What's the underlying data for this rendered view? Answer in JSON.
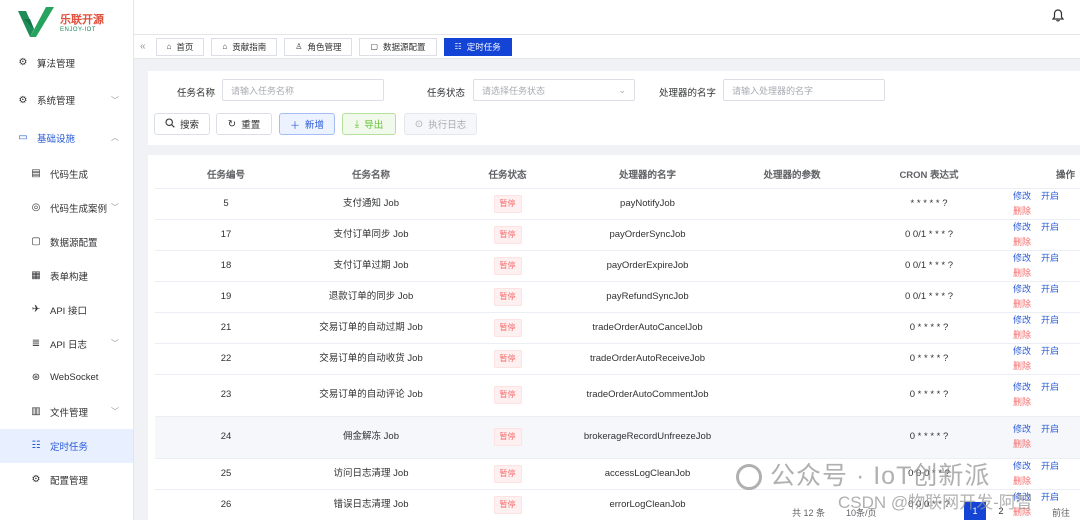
{
  "brand": {
    "title": "乐联开源",
    "subtitle": "ENJOY-IOT"
  },
  "sidebar": {
    "items": [
      {
        "label": "算法管理",
        "icon": "gear-icon",
        "level": 1
      },
      {
        "label": "系统管理",
        "icon": "gear-icon",
        "level": 1,
        "arrow": "down"
      },
      {
        "label": "基础设施",
        "icon": "monitor-icon",
        "level": 1,
        "arrow": "up",
        "open": true
      },
      {
        "label": "代码生成",
        "icon": "document-icon",
        "level": 2
      },
      {
        "label": "代码生成案例",
        "icon": "target-icon",
        "level": 2,
        "arrow": "down"
      },
      {
        "label": "数据源配置",
        "icon": "chat-icon",
        "level": 2
      },
      {
        "label": "表单构建",
        "icon": "form-icon",
        "level": 2
      },
      {
        "label": "API 接口",
        "icon": "plane-icon",
        "level": 2
      },
      {
        "label": "API 日志",
        "icon": "list-icon",
        "level": 2,
        "arrow": "down"
      },
      {
        "label": "WebSocket",
        "icon": "websocket-icon",
        "level": 2
      },
      {
        "label": "文件管理",
        "icon": "file-icon",
        "level": 2,
        "arrow": "down"
      },
      {
        "label": "定时任务",
        "icon": "task-list-icon",
        "level": 2,
        "active": true
      },
      {
        "label": "配置管理",
        "icon": "settings-icon",
        "level": 2
      }
    ]
  },
  "tags": [
    {
      "label": "首页",
      "icon": "home-icon"
    },
    {
      "label": "贡献指南",
      "icon": "home-icon"
    },
    {
      "label": "角色管理",
      "icon": "user-icon"
    },
    {
      "label": "数据源配置",
      "icon": "chat-icon"
    },
    {
      "label": "定时任务",
      "icon": "task-list-icon",
      "active": true
    }
  ],
  "search": {
    "name_label": "任务名称",
    "name_placeholder": "请输入任务名称",
    "status_label": "任务状态",
    "status_placeholder": "请选择任务状态",
    "handler_label": "处理器的名字",
    "handler_placeholder": "请输入处理器的名字",
    "btn_search": "搜索",
    "btn_reset": "重置",
    "btn_add": "新增",
    "btn_export": "导出",
    "btn_log": "执行日志"
  },
  "table": {
    "headers": [
      "任务编号",
      "任务名称",
      "任务状态",
      "处理器的名字",
      "处理器的参数",
      "CRON 表达式",
      "操作"
    ],
    "ops": {
      "edit": "修改",
      "start": "开启",
      "delete": "删除"
    },
    "rows": [
      {
        "id": "5",
        "name": "支付通知 Job",
        "status": "暂停",
        "handler": "payNotifyJob",
        "param": "",
        "cron": "* * * * * ?"
      },
      {
        "id": "17",
        "name": "支付订单同步 Job",
        "status": "暂停",
        "handler": "payOrderSyncJob",
        "param": "",
        "cron": "0 0/1 * * * ?"
      },
      {
        "id": "18",
        "name": "支付订单过期 Job",
        "status": "暂停",
        "handler": "payOrderExpireJob",
        "param": "",
        "cron": "0 0/1 * * * ?"
      },
      {
        "id": "19",
        "name": "退款订单的同步 Job",
        "status": "暂停",
        "handler": "payRefundSyncJob",
        "param": "",
        "cron": "0 0/1 * * * ?"
      },
      {
        "id": "21",
        "name": "交易订单的自动过期 Job",
        "status": "暂停",
        "handler": "tradeOrderAutoCancelJob",
        "param": "",
        "cron": "0 * * * * ?"
      },
      {
        "id": "22",
        "name": "交易订单的自动收货 Job",
        "status": "暂停",
        "handler": "tradeOrderAutoReceiveJob",
        "param": "",
        "cron": "0 * * * * ?"
      },
      {
        "id": "23",
        "name": "交易订单的自动评论 Job",
        "status": "暂停",
        "handler": "tradeOrderAutoCommentJob",
        "param": "",
        "cron": "0 * * * * ?"
      },
      {
        "id": "24",
        "name": "佣金解冻 Job",
        "status": "暂停",
        "handler": "brokerageRecordUnfreezeJob",
        "param": "",
        "cron": "0 * * * * ?"
      },
      {
        "id": "25",
        "name": "访问日志清理 Job",
        "status": "暂停",
        "handler": "accessLogCleanJob",
        "param": "",
        "cron": "0 0 0 * * ?"
      },
      {
        "id": "26",
        "name": "错误日志清理 Job",
        "status": "暂停",
        "handler": "errorLogCleanJob",
        "param": "",
        "cron": "0 0 0 * * ?"
      }
    ]
  },
  "pagination": {
    "total": "共 12 条",
    "size": "10条/页",
    "pages": [
      "1",
      "2"
    ],
    "current": "1",
    "goto": "前往"
  },
  "watermark": {
    "line1": "公众号 · IoT创新派",
    "line2": "CSDN @物联网开发-阿智"
  },
  "colors": {
    "primary": "#1444d6",
    "danger": "#f56c6c",
    "success": "#67c23a"
  }
}
